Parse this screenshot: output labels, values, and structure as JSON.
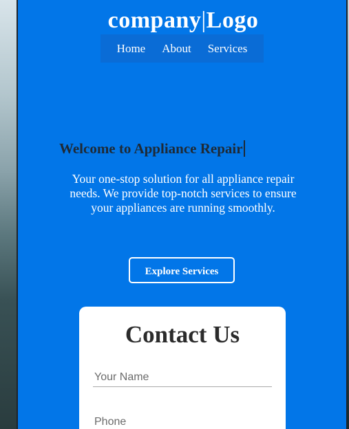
{
  "header": {
    "brand_left": "company",
    "brand_sep": "|",
    "brand_right": "Logo"
  },
  "nav": {
    "items": [
      {
        "label": "Home"
      },
      {
        "label": "About"
      },
      {
        "label": "Services"
      }
    ]
  },
  "hero": {
    "title": "Welcome to Appliance Repair",
    "text": "Your one-stop solution for all appliance repair needs. We provide top-notch services to ensure your appliances are running smoothly.",
    "cta_label": "Explore Services"
  },
  "contact": {
    "title": "Contact Us",
    "name_placeholder": "Your Name",
    "phone_placeholder": "Phone"
  },
  "colors": {
    "primary": "#0276e8",
    "nav_bg": "#0a6cd6",
    "title_text": "#1e2a36",
    "card_bg": "#ffffff"
  }
}
